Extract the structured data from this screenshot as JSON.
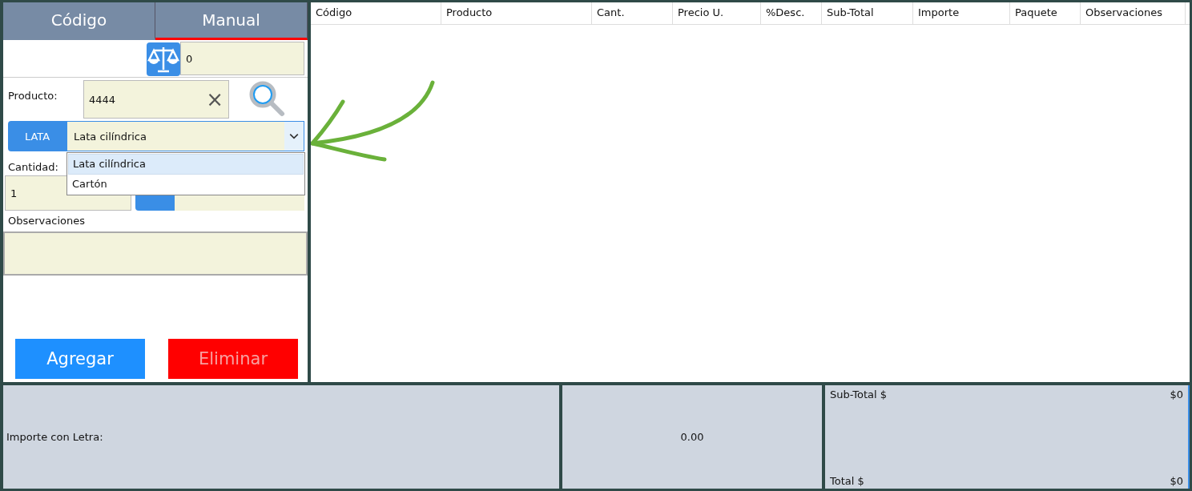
{
  "tabs": [
    {
      "label": "Código",
      "selected": false
    },
    {
      "label": "Manual",
      "selected": true
    }
  ],
  "scale": {
    "value": "0"
  },
  "product": {
    "label": "Producto:",
    "value": "4444",
    "clear": "×"
  },
  "package": {
    "button": "LATA",
    "value": "Lata cilíndrica",
    "expanded": true,
    "options": [
      {
        "label": "Lata cilíndrica",
        "selected": true
      },
      {
        "label": "Cartón",
        "selected": false
      }
    ]
  },
  "quantity": {
    "label": "Cantidad:",
    "value": "1"
  },
  "notes": {
    "label": "Observaciones"
  },
  "buttons": [
    {
      "label": "Agregar",
      "kind": "add"
    },
    {
      "label": "Eliminar",
      "kind": "delete"
    }
  ],
  "table": {
    "columns": [
      "Código",
      "Producto",
      "Cant.",
      "Precio U.",
      "%Desc.",
      "Sub-Total",
      "Importe",
      "Paquete",
      "Observaciones"
    ]
  },
  "footer": {
    "words_label": "Importe con Letra:",
    "amount": "0.00",
    "subtotal_label": "Sub-Total $",
    "subtotal": "$0",
    "total_label": "Total $",
    "total": "$0"
  }
}
